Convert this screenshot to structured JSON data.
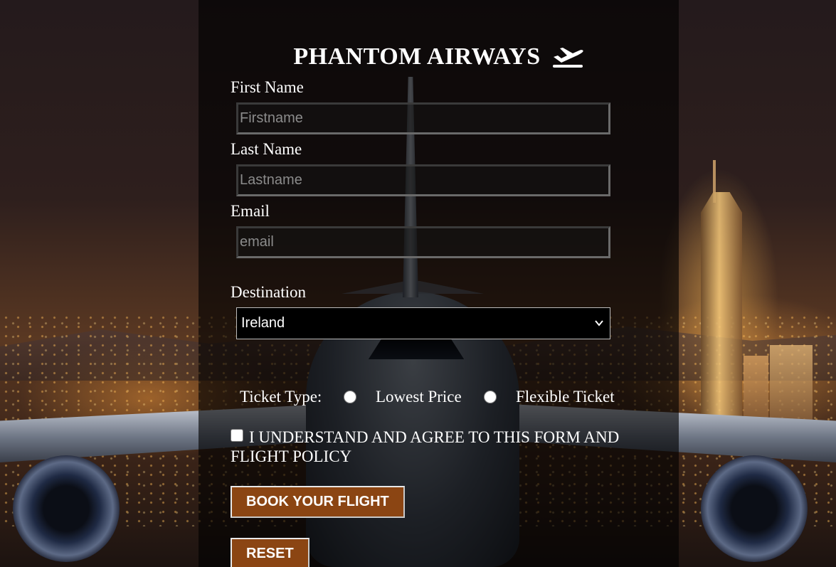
{
  "header": {
    "title": "PHANTOM AIRWAYS",
    "title_icon": "airplane-departure-icon"
  },
  "form": {
    "first_name": {
      "label": "First Name",
      "placeholder": "Firstname",
      "value": ""
    },
    "last_name": {
      "label": "Last Name",
      "placeholder": "Lastname",
      "value": ""
    },
    "email": {
      "label": "Email",
      "placeholder": "email",
      "value": ""
    },
    "destination": {
      "label": "Destination",
      "selected": "Ireland"
    },
    "ticket_type": {
      "label": "Ticket Type:",
      "options": [
        "Lowest Price",
        "Flexible Ticket"
      ],
      "selected": null
    },
    "agreement": {
      "label": "I UNDERSTAND AND AGREE TO THIS FORM AND FLIGHT POLICY",
      "checked": false
    },
    "submit_label": "BOOK YOUR FLIGHT",
    "reset_label": "RESET"
  },
  "colors": {
    "button_bg": "#8b4513",
    "panel_bg": "rgba(0,0,0,0.62)",
    "text": "#ffffff"
  }
}
